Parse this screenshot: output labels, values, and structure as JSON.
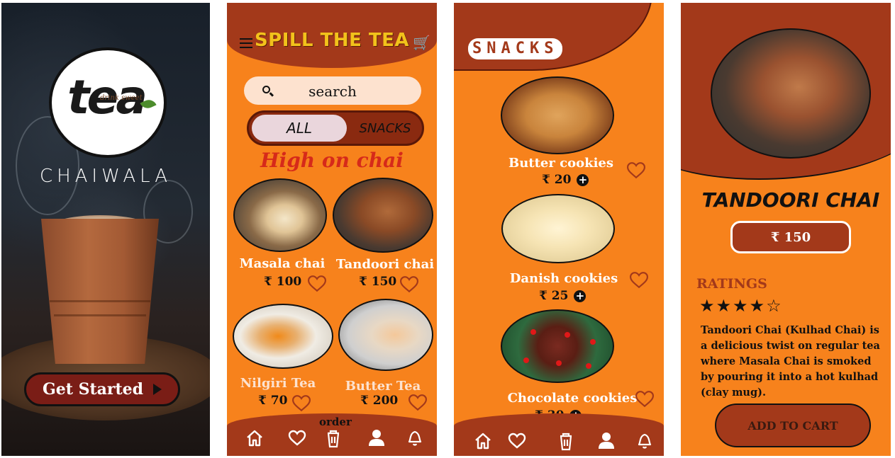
{
  "splash": {
    "logo_word": "tea",
    "logo_tagline": "drink sweet",
    "brand_name": "CHAIWALA",
    "get_started_label": "Get Started"
  },
  "home": {
    "title": "SPILL THE TEA",
    "search_placeholder": "search",
    "tabs": [
      {
        "label": "ALL",
        "selected": true
      },
      {
        "label": "SNACKS",
        "selected": false
      }
    ],
    "section_heading": "High on chai",
    "items": [
      {
        "name": "Masala chai",
        "price": "₹ 100"
      },
      {
        "name": "Tandoori chai",
        "price": "₹ 150"
      },
      {
        "name": "Nilgiri Tea",
        "price": "₹ 70"
      },
      {
        "name": "Butter Tea",
        "price": "₹ 200"
      }
    ],
    "nav_order_label": "order"
  },
  "snacks": {
    "title": "SNACKS",
    "items": [
      {
        "name": "Butter cookies",
        "price": "₹ 20"
      },
      {
        "name": "Danish cookies",
        "price": "₹ 25"
      },
      {
        "name": "Chocolate cookies",
        "price": "₹ 30"
      }
    ]
  },
  "detail": {
    "title": "TANDOORI CHAI",
    "price": "₹ 150",
    "ratings_label": "RATINGS",
    "rating": 4,
    "rating_max": 5,
    "stars_text": "★★★★☆",
    "description": "Tandoori Chai (Kulhad Chai) is a delicious twist on regular tea where Masala Chai is smoked by pouring it into a hot kulhad (clay mug).",
    "add_to_cart_label": "ADD TO CART"
  },
  "colors": {
    "orange_bg": "#f7821c",
    "rust": "#a3391a",
    "title_yellow": "#f2c21b",
    "heading_red": "#d62a1a",
    "button_maroon": "#7a1d16"
  },
  "icons": [
    "menu-icon",
    "cart-icon",
    "search-icon",
    "heart-icon",
    "home-icon",
    "trash-icon",
    "user-icon",
    "bell-icon",
    "play-icon",
    "add-icon",
    "star-icon"
  ]
}
